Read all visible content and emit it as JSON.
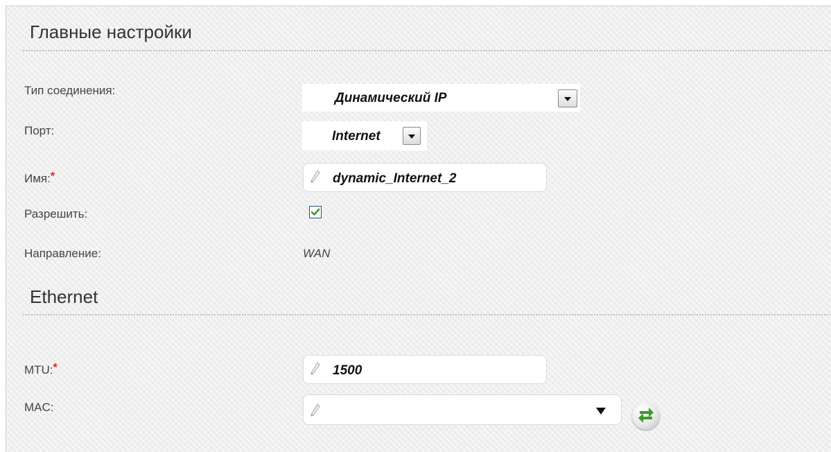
{
  "main_settings": {
    "title": "Главные настройки",
    "connection_type": {
      "label": "Тип соединения:",
      "value": "Динамический IP"
    },
    "port": {
      "label": "Порт:",
      "value": "Internet"
    },
    "name": {
      "label": "Имя:",
      "required_mark": "*",
      "value": "dynamic_Internet_2"
    },
    "enable": {
      "label": "Разрешить:",
      "checked": true
    },
    "direction": {
      "label": "Направление:",
      "value": "WAN"
    }
  },
  "ethernet": {
    "title": "Ethernet",
    "mtu": {
      "label": "MTU:",
      "required_mark": "*",
      "value": "1500"
    },
    "mac": {
      "label": "MAC:",
      "value": ""
    }
  },
  "icons": {
    "dropdown": "chevron-down-icon",
    "edit": "pencil-icon",
    "check": "checkmark-icon",
    "refresh": "swap-arrows-icon"
  },
  "colors": {
    "required": "#e02020",
    "accent_green": "#3a9b2a"
  }
}
